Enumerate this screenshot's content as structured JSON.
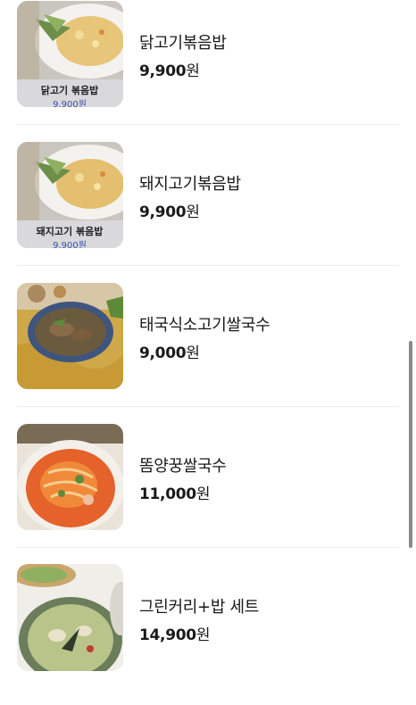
{
  "menu": {
    "items": [
      {
        "name": "닭고기볶음밥",
        "price": "9,900",
        "currency": "원",
        "image_caption": "닭고기 볶음밥",
        "image_price": "9,900원"
      },
      {
        "name": "돼지고기볶음밥",
        "price": "9,900",
        "currency": "원",
        "image_caption": "돼지고기 볶음밥",
        "image_price": "9,900원"
      },
      {
        "name": "태국식소고기쌀국수",
        "price": "9,000",
        "currency": "원"
      },
      {
        "name": "똠양꿍쌀국수",
        "price": "11,000",
        "currency": "원"
      },
      {
        "name": "그린커리+밥 세트",
        "price": "14,900",
        "currency": "원"
      }
    ]
  }
}
